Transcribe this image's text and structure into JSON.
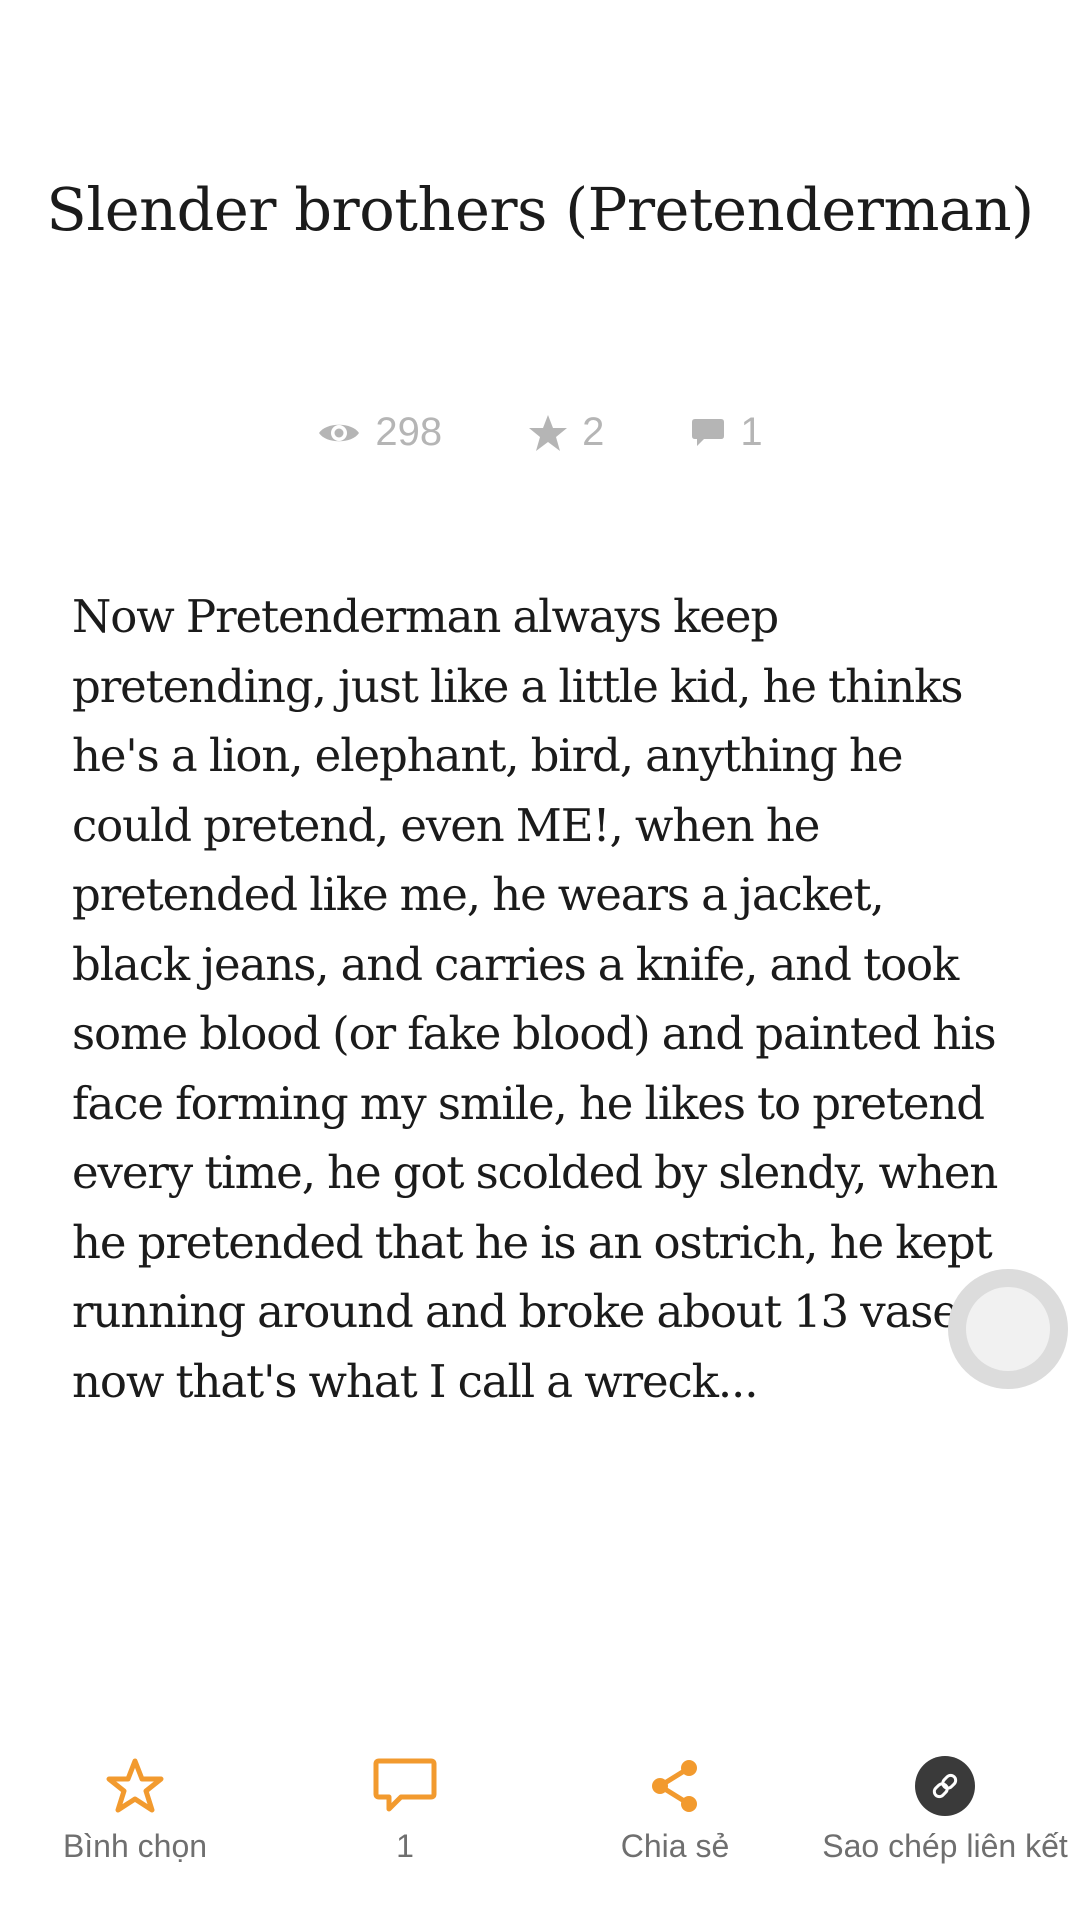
{
  "story": {
    "title": "Slender brothers (Pretenderman)",
    "stats": {
      "views": "298",
      "votes": "2",
      "comments": "1"
    },
    "body": "Now Pretenderman always keep pretending, just like a little kid, he thinks he's a lion, elephant, bird, anything he could pretend, even ME!, when he pretended like me, he wears a jacket, black jeans, and carries a knife, and took some blood (or fake blood) and painted his face forming my smile, he likes to pretend every time, he got scolded by slendy, when he pretended that he is an ostrich, he kept running around and broke about 13 vases, now that's what I call a wreck..."
  },
  "actions": {
    "vote_label": "Bình chọn",
    "comment_count": "1",
    "share_label": "Chia sẻ",
    "copy_link_label": "Sao chép liên kết"
  },
  "icons": {
    "views": "eye-icon",
    "votes": "star-icon",
    "comments": "comment-icon",
    "vote": "star-outline-icon",
    "comment": "comment-outline-icon",
    "share": "share-icon",
    "copy_link": "link-icon"
  },
  "colors": {
    "accent": "#f29a2e",
    "stat_gray": "#b5b5b5",
    "text": "#1b1b1b",
    "label_gray": "#6f6f6f",
    "link_circle": "#3a3a3a"
  }
}
